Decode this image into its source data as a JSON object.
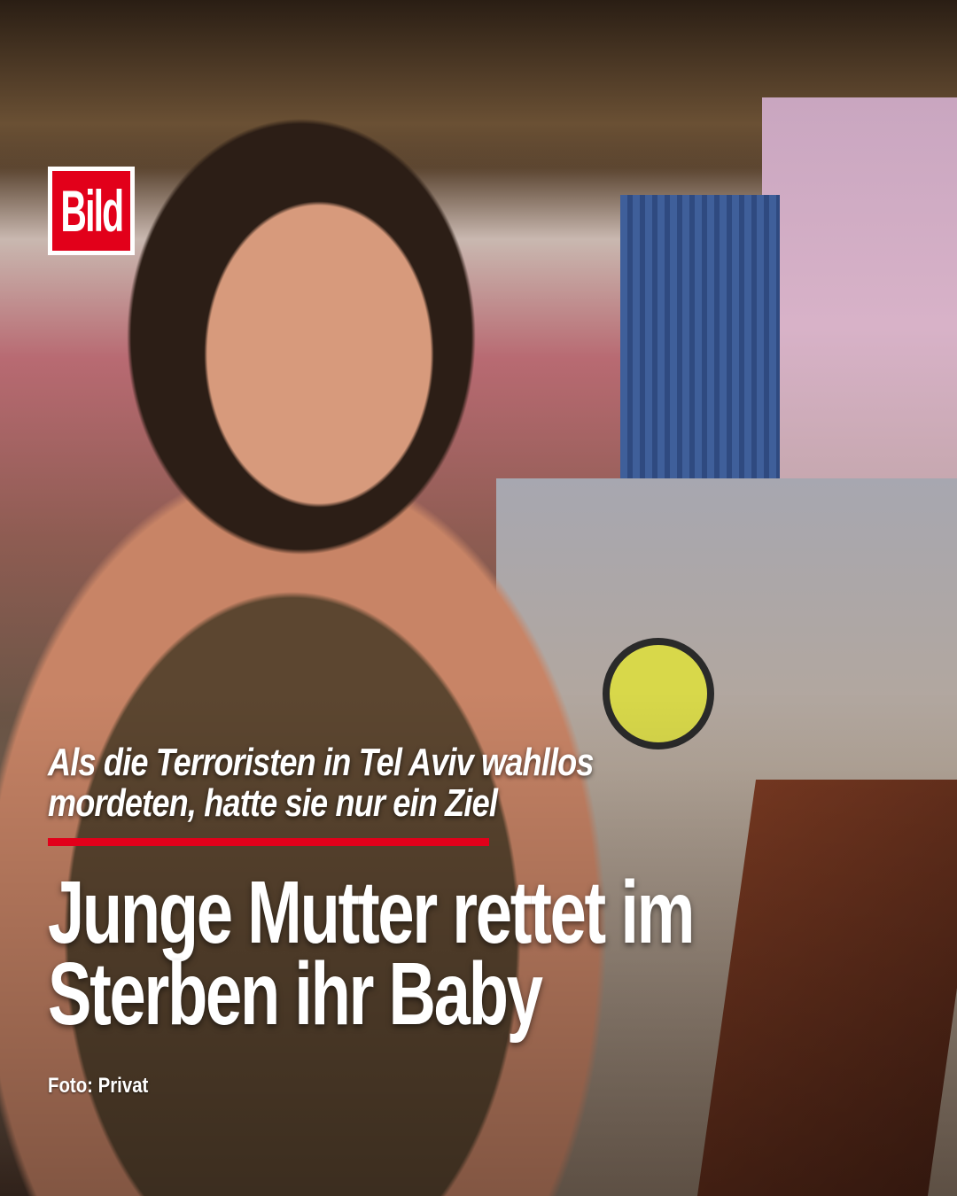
{
  "brand": {
    "logo_text": "Bild",
    "color": "#e2001a"
  },
  "post": {
    "kicker_line1": "Als die Terroristen in Tel Aviv wahllos",
    "kicker_line2": "mordeten, hatte sie nur ein Ziel",
    "headline_line1": "Junge Mutter rettet im",
    "headline_line2": "Sterben ihr Baby",
    "photo_credit": "Foto: Privat"
  }
}
